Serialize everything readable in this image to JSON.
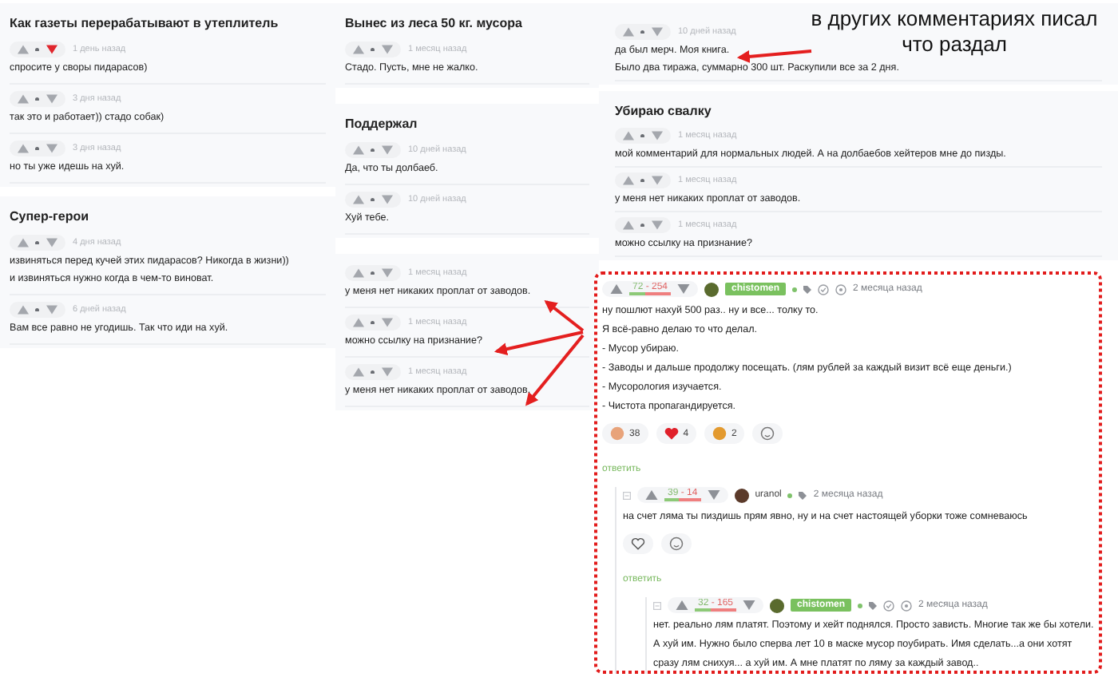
{
  "columns": [
    {
      "sections": [
        {
          "title": "Как газеты перерабатывают в утеплитель",
          "comments": [
            {
              "time": "1 день назад",
              "downvoted": true,
              "text": [
                "спросите у своры пидарасов)"
              ]
            },
            {
              "time": "3 дня назад",
              "downvoted": false,
              "text": [
                "так это и работает)) стадо собак)"
              ]
            },
            {
              "time": "3 дня назад",
              "downvoted": false,
              "text": [
                "но ты уже идешь на хуй."
              ]
            }
          ]
        },
        {
          "title": "Супер-герои",
          "comments": [
            {
              "time": "4 дня назад",
              "downvoted": false,
              "text": [
                "извиняться перед кучей этих пидарасов? Никогда в жизни))",
                "и извиняться нужно когда в чем-то виноват."
              ]
            },
            {
              "time": "6 дней назад",
              "downvoted": false,
              "text": [
                "Вам все равно не угодишь. Так что иди на хуй."
              ]
            }
          ]
        }
      ]
    },
    {
      "sections": [
        {
          "title": "Вынес из леса 50 кг. мусора",
          "comments": [
            {
              "time": "1 месяц назад",
              "downvoted": false,
              "text": [
                "Стадо. Пусть, мне не жалко."
              ]
            }
          ]
        },
        {
          "title": "Поддержал",
          "comments": [
            {
              "time": "10 дней назад",
              "downvoted": false,
              "text": [
                "Да, что ты долбаеб."
              ]
            },
            {
              "time": "10 дней назад",
              "downvoted": false,
              "text": [
                "Хуй тебе."
              ]
            }
          ]
        },
        {
          "comments": [
            {
              "time": "1 месяц назад",
              "downvoted": false,
              "text": [
                "у меня нет никаких проплат от заводов."
              ]
            },
            {
              "time": "1 месяц назад",
              "downvoted": false,
              "text": [
                "можно ссылку на признание?"
              ]
            },
            {
              "time": "1 месяц назад",
              "downvoted": false,
              "text": [
                "у меня нет никаких проплат от заводов."
              ]
            }
          ]
        }
      ]
    },
    {
      "sections": [
        {
          "comments": [
            {
              "time": "10 дней назад",
              "downvoted": false,
              "text": [
                "да был мерч. Моя книга.",
                "Было два тиража, суммарно 300 шт. Раскупили все за 2 дня."
              ]
            }
          ]
        },
        {
          "title": "Убираю свалку",
          "comments": [
            {
              "time": "1 месяц назад",
              "downvoted": false,
              "text": [
                "мой комментарий для нормальных людей. А на долбаебов хейтеров мне до пизды."
              ]
            },
            {
              "time": "1 месяц назад",
              "downvoted": false,
              "text": [
                "у меня нет никаких проплат от заводов."
              ]
            },
            {
              "time": "1 месяц назад",
              "downvoted": false,
              "text": [
                "можно ссылку на признание?"
              ]
            }
          ]
        }
      ]
    }
  ],
  "annotation": "в других комментариях писал что раздал",
  "thread": {
    "score": "72 - 254",
    "user": "chistomen",
    "badge": true,
    "time": "2 месяца назад",
    "lines": [
      "ну пошлют нахуй 500 раз.. ну и все... толку то.",
      "Я всё-равно делаю то что делал.",
      "- Мусор убираю.",
      "- Заводы и дальше продолжу посещать. (лям рублей за каждый визит всё еще деньги.)",
      "- Мусорология изучается.",
      "- Чистота пропагандируется."
    ],
    "reactions": [
      {
        "kind": "bear",
        "count": "38"
      },
      {
        "kind": "heart",
        "count": "4"
      },
      {
        "kind": "tiger",
        "count": "2"
      },
      {
        "kind": "add"
      }
    ],
    "reply": "ответить",
    "children": [
      {
        "score": "39 - 14",
        "user": "uranol",
        "badge": false,
        "time": "2 месяца назад",
        "lines": [
          "на счет ляма ты пиздишь прям явно, ну и на счет настоящей уборки тоже сомневаюсь"
        ],
        "reactions": [
          {
            "kind": "heart-outline"
          },
          {
            "kind": "add"
          }
        ],
        "reply": "ответить",
        "children": [
          {
            "score": "32 - 165",
            "user": "chistomen",
            "badge": true,
            "time": "2 месяца назад",
            "lines": [
              "нет. реально лям платят. Поэтому и хейт поднялся. Просто зависть. Многие так же бы хотели. А хуй им. Нужно было сперва лет 10 в маске мусор поубирать. Имя сделать...а они хотят сразу лям снихуя... а хуй им. А мне платят по ляму за каждый завод.."
            ]
          }
        ]
      }
    ]
  }
}
